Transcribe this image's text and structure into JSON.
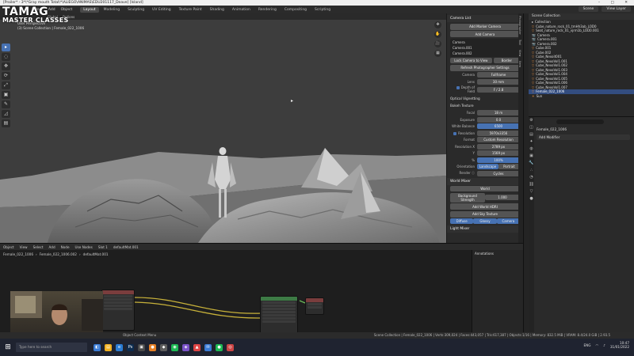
{
  "titlebar": {
    "title": "[Proiler* - 3*\\*Gray mouth Total\\*\\ALIEGO\\ANIMAS\\EDU201117_Deave] [Island]",
    "controls": "– □ ✕"
  },
  "logo": {
    "line1": "TAMAG",
    "line2": "MASTER CLASSES"
  },
  "menu": [
    "Select",
    "Add",
    "Object"
  ],
  "workspace_tabs": [
    {
      "label": "Layout",
      "active": true
    },
    {
      "label": "Modeling"
    },
    {
      "label": "Sculpting"
    },
    {
      "label": "UV Editing"
    },
    {
      "label": "Texture Paint"
    },
    {
      "label": "Shading"
    },
    {
      "label": "Animation"
    },
    {
      "label": "Rendering"
    },
    {
      "label": "Compositing"
    },
    {
      "label": "Scripting"
    }
  ],
  "topright": {
    "scene": "Scene",
    "view_layer": "View Layer"
  },
  "viewport": {
    "header": [
      "Global",
      "Options"
    ],
    "info_line1": "User Perspective",
    "info_line2": "(3) Scene Collection | Female_022_1006",
    "tools": [
      "▸",
      "◌",
      "✥",
      "⟳",
      "⤢",
      "▣",
      "✎",
      "◿",
      "▤"
    ],
    "gizmos": [
      "✥",
      "✋",
      "🎥",
      "▦"
    ]
  },
  "npanel": {
    "camera_list_hdr": "Camera List",
    "add_marker": "Add Marker Camera",
    "add_camera": "Add Camera",
    "cameras": [
      "Camera",
      "Camera.001",
      "Camera.002"
    ],
    "lock_camera": "Lock Camera to View",
    "border": "Border",
    "refresh": "Refresh Photographer Settings",
    "camera_label": "Camera",
    "camera_val": "Fullframe",
    "lens_label": "Lens",
    "lens_val": "30 mm",
    "dof_label": "Depth of Field",
    "dof_val": "F / 2.8",
    "optical": "Optical Vignetting",
    "bokeh": "Bokeh Texture",
    "focal_label": "Focal",
    "focal_val": "18 m",
    "exposure_label": "Exposure",
    "exposure_val": "0.0",
    "wb_label": "White Balance",
    "wb_val": "6500",
    "resolution_label": "Resolution",
    "resolution_val": "5970x3356",
    "format_label": "Format",
    "format_val": "Custom Resolution",
    "resx_label": "Resolution X",
    "resx_val": "2789 px",
    "resy_label": "Y",
    "resy_val": "1569 px",
    "pct_label": "%",
    "pct_val": "100%",
    "orient_label": "Orientation",
    "orient_a": "Landscape",
    "orient_b": "Portrait",
    "render_label": "Render ⓘ",
    "render_val": "Cycles",
    "world_mixer": "World Mixer",
    "world_name": "World",
    "bg_strength_label": "Background Strength",
    "bg_strength_val": "1.000",
    "add_hdri": "Add World HDRI",
    "add_sky": "Add Sky Texture",
    "diffuse": "Diffuse",
    "glossy": "Glossy",
    "camera_btn": "Camera",
    "light_mixer": "Light Mixer",
    "side_tabs": [
      "Photographer",
      "Tool",
      "View",
      "Item"
    ]
  },
  "outliner": {
    "header": "Scene Collection",
    "items": [
      {
        "label": "Collection",
        "icon": "▸",
        "coll": true
      },
      {
        "label": "Cube_nature_rock_01_tmHh3ab_LOD0",
        "icon": "▽"
      },
      {
        "label": "Seat_nature_rock_01_vjrm1b_LOD0.001",
        "icon": "▽"
      },
      {
        "label": "Camera",
        "icon": "📷"
      },
      {
        "label": "Camera.001",
        "icon": "📷"
      },
      {
        "label": "Camera.002",
        "icon": "📷"
      },
      {
        "label": "Cube.001",
        "icon": "▽"
      },
      {
        "label": "Cube.002",
        "icon": "▽"
      },
      {
        "label": "Cube_Nexoit001",
        "icon": "▽"
      },
      {
        "label": "Cube_NexoVol1.001",
        "icon": "▽"
      },
      {
        "label": "Cube_NexoVol1.002",
        "icon": "▽"
      },
      {
        "label": "Cube_NexoVol1.003",
        "icon": "▽"
      },
      {
        "label": "Cube_NexoVol1.004",
        "icon": "▽"
      },
      {
        "label": "Cube_NexoVol1.005",
        "icon": "▽"
      },
      {
        "label": "Cube_NexoVol1.006",
        "icon": "▽"
      },
      {
        "label": "Cube_NexoVol1.007",
        "icon": "▽"
      },
      {
        "label": "Female_022_1006",
        "icon": "▽",
        "sel": true
      },
      {
        "label": "Sun",
        "icon": "☀"
      }
    ]
  },
  "properties": {
    "object_name": "Female_022_1006",
    "add_modifier": "Add Modifier"
  },
  "node_editor": {
    "header": [
      "Object",
      "View",
      "Select",
      "Add",
      "Node",
      "Use Nodes"
    ],
    "slot": "Slot 1",
    "material": "defaultMat.001",
    "breadcrumb": [
      "Female_022_1006",
      "›",
      "Female_022_1006.002",
      "›",
      "defaultMat.001"
    ],
    "annotations": "Annotations"
  },
  "statusbar": {
    "left": "Object Context Menu",
    "right": "Scene Collection | Female_022_1006 | Verts:309,024 | Faces:443,057 | Tris:617,387 | Objects:1/16 | Memory: 832.5 MiB | VRAM: 8.4/24.0 GiB | 2.93.5"
  },
  "taskbar": {
    "search": "Type here to search",
    "apps": [
      {
        "g": "◧",
        "c": "#3a7bd5"
      },
      {
        "g": "▤",
        "c": "#f2b01e"
      },
      {
        "g": "e",
        "c": "#2b7cd3"
      },
      {
        "g": "Ps",
        "c": "#0d2c4f"
      },
      {
        "g": "▣",
        "c": "#4a4a4a"
      },
      {
        "g": "●",
        "c": "#e57f25"
      },
      {
        "g": "◆",
        "c": "#5c5c5c"
      },
      {
        "g": "◉",
        "c": "#1db954"
      },
      {
        "g": "◈",
        "c": "#7a52c7"
      },
      {
        "g": "▲",
        "c": "#d44"
      },
      {
        "g": "✉",
        "c": "#3a7bd5"
      },
      {
        "g": "●",
        "c": "#1db954"
      },
      {
        "g": "◎",
        "c": "#c44"
      }
    ],
    "lang": "ENG",
    "time": "10:47",
    "date": "31/01/2022"
  }
}
